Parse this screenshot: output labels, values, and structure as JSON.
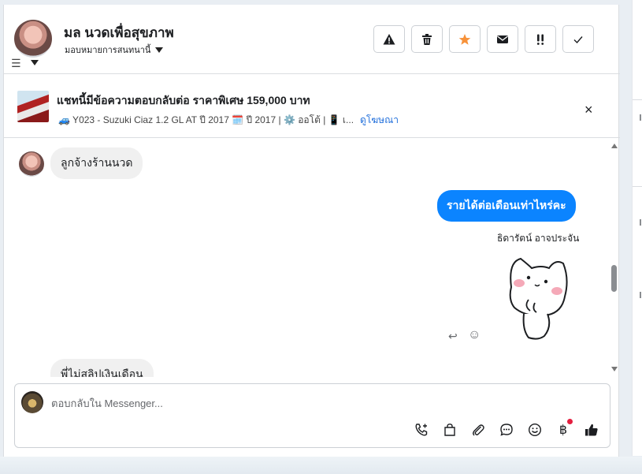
{
  "header": {
    "contact_name": "มล นวดเพื่อสุขภาพ",
    "assign_label": "มอบหมายการสนทนานี้",
    "icons": {
      "avatar": "avatar",
      "filter": "filter-icon",
      "dropdown": "chevron-down-icon"
    },
    "actions": [
      {
        "name": "report-button",
        "icon": "warning-icon",
        "glyph": "⚠"
      },
      {
        "name": "delete-button",
        "icon": "trash-icon",
        "glyph": "🗑"
      },
      {
        "name": "star-button",
        "icon": "star-icon",
        "glyph": "★",
        "color": "#f7923a"
      },
      {
        "name": "mark-unread-button",
        "icon": "envelope-icon",
        "glyph": "✉"
      },
      {
        "name": "mark-important-button",
        "icon": "exclamation-icon",
        "glyph": "!!"
      },
      {
        "name": "mark-done-button",
        "icon": "check-icon",
        "glyph": "✓"
      }
    ]
  },
  "ad": {
    "title": "แชทนี้มีข้อความตอบกลับต่อ ราคาพิเศษ 159,000 บาท",
    "details": "🚙 Y023 - Suzuki Ciaz 1.2 GL AT ปี 2017 🗓️ ปี 2017 | ⚙️ ออโต้ | 📱 เ...",
    "link": "ดูโฆษณา",
    "close_icon": "×"
  },
  "messages": [
    {
      "direction": "in",
      "text": "ลูกจ้างร้านนวด"
    },
    {
      "direction": "out",
      "text": "รายได้ต่อเดือนเท่าไหร่คะ"
    },
    {
      "direction": "out",
      "type": "sticker",
      "sender": "ธิดารัตน์ อาจประจัน"
    },
    {
      "direction": "in",
      "text": "พี่ไม่สลิปเงินเดือน"
    }
  ],
  "message_actions": {
    "reply_glyph": "↩",
    "react_glyph": "☺"
  },
  "composer": {
    "placeholder": "ตอบกลับใน Messenger...",
    "value": "",
    "tools": [
      {
        "name": "call-button",
        "icon": "phone-plus-icon"
      },
      {
        "name": "shop-button",
        "icon": "bag-icon"
      },
      {
        "name": "attach-button",
        "icon": "paperclip-icon"
      },
      {
        "name": "saved-replies-button",
        "icon": "chat-bubble-icon"
      },
      {
        "name": "emoji-button",
        "icon": "smile-icon"
      },
      {
        "name": "payment-button",
        "icon": "baht-icon",
        "glyph": "฿",
        "badge": true
      },
      {
        "name": "like-button",
        "icon": "thumbs-up-icon"
      }
    ]
  },
  "colors": {
    "accent": "#0b84ff",
    "link": "#216fdb",
    "star": "#f7923a",
    "badge": "#e41e3f"
  }
}
